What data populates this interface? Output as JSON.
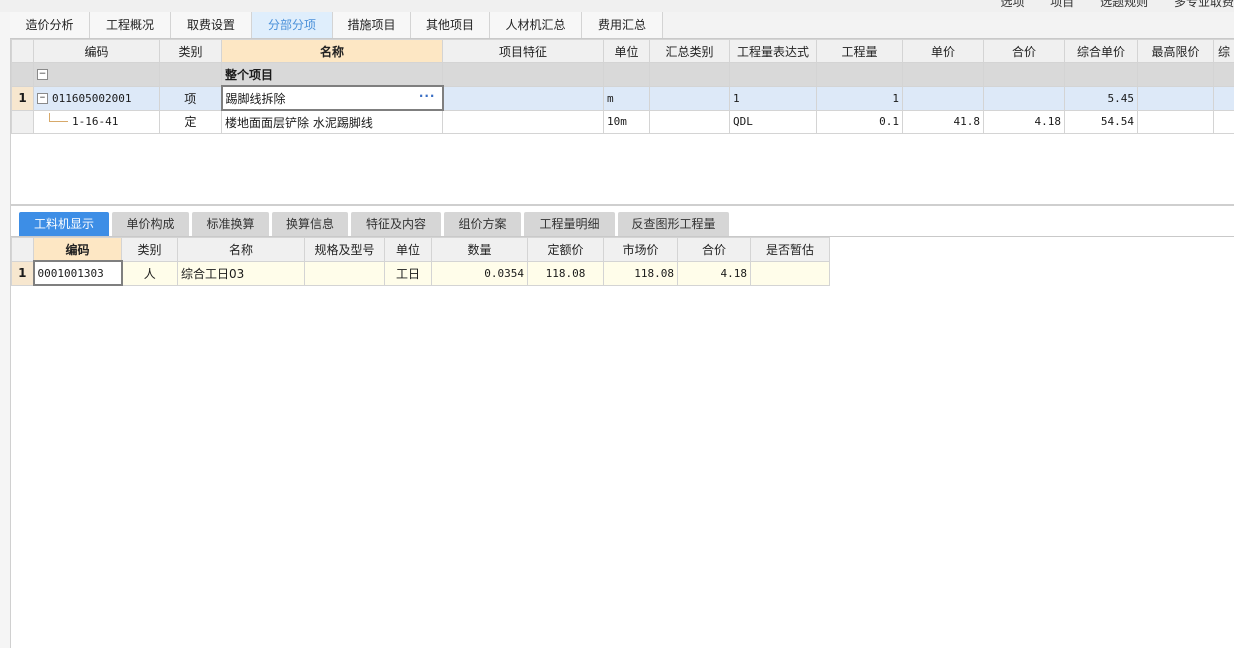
{
  "top_right_labels": [
    "选项",
    "项目",
    "选题规则",
    "多专业取费"
  ],
  "main_tabs": [
    {
      "label": "造价分析",
      "active": false
    },
    {
      "label": "工程概况",
      "active": false
    },
    {
      "label": "取费设置",
      "active": false
    },
    {
      "label": "分部分项",
      "active": true
    },
    {
      "label": "措施项目",
      "active": false
    },
    {
      "label": "其他项目",
      "active": false
    },
    {
      "label": "人材机汇总",
      "active": false
    },
    {
      "label": "费用汇总",
      "active": false
    }
  ],
  "bill_grid": {
    "headers": [
      "编码",
      "类别",
      "名称",
      "项目特征",
      "单位",
      "汇总类别",
      "工程量表达式",
      "工程量",
      "单价",
      "合价",
      "综合单价",
      "最高限价",
      "综"
    ],
    "group_row": {
      "name": "整个项目",
      "toggle": "−"
    },
    "rows": [
      {
        "num": "1",
        "code": "011605002001",
        "type": "项",
        "name": "踢脚线拆除",
        "ellipsis": "···",
        "feature": "",
        "unit": "m",
        "sum_type": "",
        "expr": "1",
        "qty": "1",
        "price": "",
        "total": "",
        "comp_price": "5.45",
        "max_price": "",
        "extra": "",
        "toggle": "−"
      },
      {
        "num": "",
        "code": "1-16-41",
        "type": "定",
        "name": "楼地面面层铲除 水泥踢脚线",
        "feature": "",
        "unit": "10m",
        "sum_type": "",
        "expr": "QDL",
        "qty": "0.1",
        "price": "41.8",
        "total": "4.18",
        "comp_price": "54.54",
        "max_price": "",
        "extra": ""
      }
    ]
  },
  "sub_tabs": [
    {
      "label": "工料机显示",
      "active": true
    },
    {
      "label": "单价构成",
      "active": false
    },
    {
      "label": "标准换算",
      "active": false
    },
    {
      "label": "换算信息",
      "active": false
    },
    {
      "label": "特征及内容",
      "active": false
    },
    {
      "label": "组价方案",
      "active": false
    },
    {
      "label": "工程量明细",
      "active": false
    },
    {
      "label": "反查图形工程量",
      "active": false
    }
  ],
  "res_grid": {
    "headers": [
      "编码",
      "类别",
      "名称",
      "规格及型号",
      "单位",
      "数量",
      "定额价",
      "市场价",
      "合价",
      "是否暂估"
    ],
    "rows": [
      {
        "num": "1",
        "code": "0001001303",
        "type": "人",
        "name": "综合工日03",
        "spec": "",
        "unit": "工日",
        "qty": "0.0354",
        "quota_price": "118.08",
        "market_price": "118.08",
        "total": "4.18",
        "provisional": ""
      }
    ]
  }
}
